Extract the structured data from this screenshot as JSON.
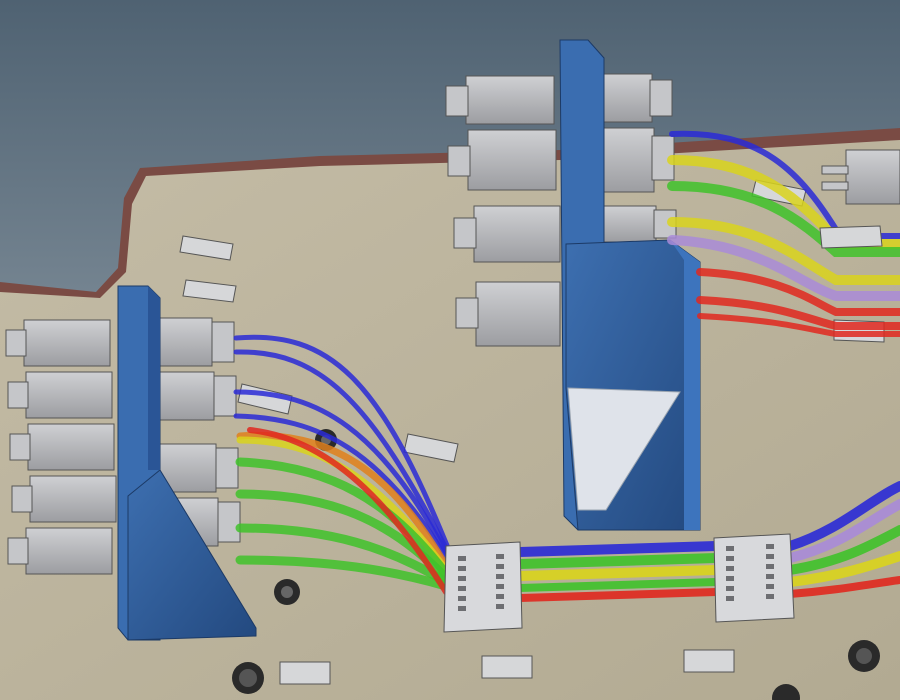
{
  "scene": {
    "kind": "cad-3d-render",
    "colors": {
      "sky_top": "#4f6272",
      "sky_bottom": "#9aa8b3",
      "plate": "#bdb59e",
      "plate_edge": "#7a4b44",
      "bracket": "#2f5f9e",
      "bracket_dark": "#1e3f73",
      "connector": "#b9babd",
      "connector_dark": "#7b7c80",
      "clip": "#d6d7d9",
      "wire_blue": "#2a2ad6",
      "wire_green": "#3fc22a",
      "wire_yellow": "#d9d41c",
      "wire_violet": "#a98bd8",
      "wire_red": "#e0281e",
      "wire_orange": "#e0801c"
    },
    "icons": [
      "connector-block-icon",
      "cable-clip-icon",
      "mounting-hole-icon",
      "terminal-block-icon"
    ]
  }
}
